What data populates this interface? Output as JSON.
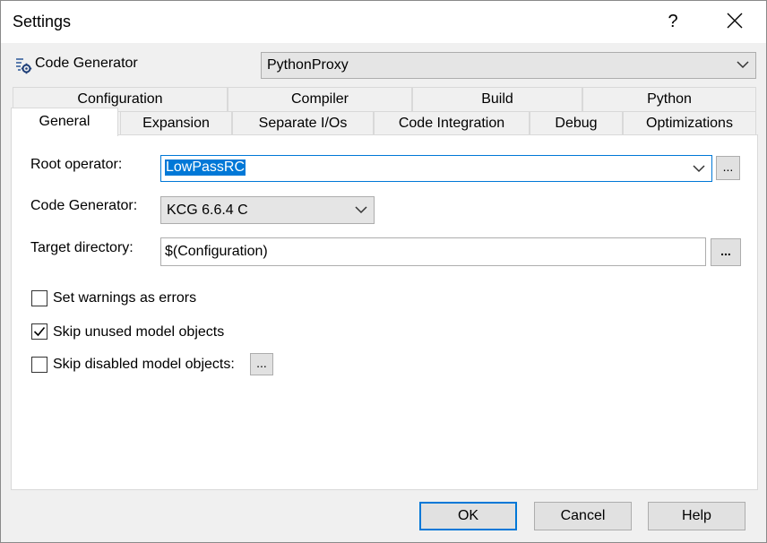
{
  "window": {
    "title": "Settings",
    "help_label": "?"
  },
  "code_generator_row": {
    "label": "Code Generator",
    "selected": "PythonProxy"
  },
  "tabs_row1": [
    "Configuration",
    "Compiler",
    "Build",
    "Python"
  ],
  "tabs_row2": [
    "General",
    "Expansion",
    "Separate I/Os",
    "Code Integration",
    "Debug",
    "Optimizations"
  ],
  "selected_tab": "General",
  "general": {
    "root_operator_label": "Root operator:",
    "root_operator_value": "LowPassRC",
    "root_operator_browse": "...",
    "code_generator_label": "Code Generator:",
    "code_generator_value": "KCG 6.6.4 C",
    "target_directory_label": "Target directory:",
    "target_directory_value": "$(Configuration)",
    "target_directory_browse": "...",
    "checkboxes": [
      {
        "label": "Set warnings as errors",
        "checked": false
      },
      {
        "label": "Skip unused model objects",
        "checked": true
      },
      {
        "label": "Skip disabled model objects:",
        "checked": false
      }
    ],
    "skip_disabled_browse": "..."
  },
  "footer": {
    "ok": "OK",
    "cancel": "Cancel",
    "help": "Help"
  },
  "colors": {
    "accent": "#0078d7",
    "selection": "#0078d7"
  },
  "icons": [
    "code-generator-icon",
    "help-icon",
    "close-icon",
    "chevron-down-icon",
    "checkmark-icon"
  ]
}
